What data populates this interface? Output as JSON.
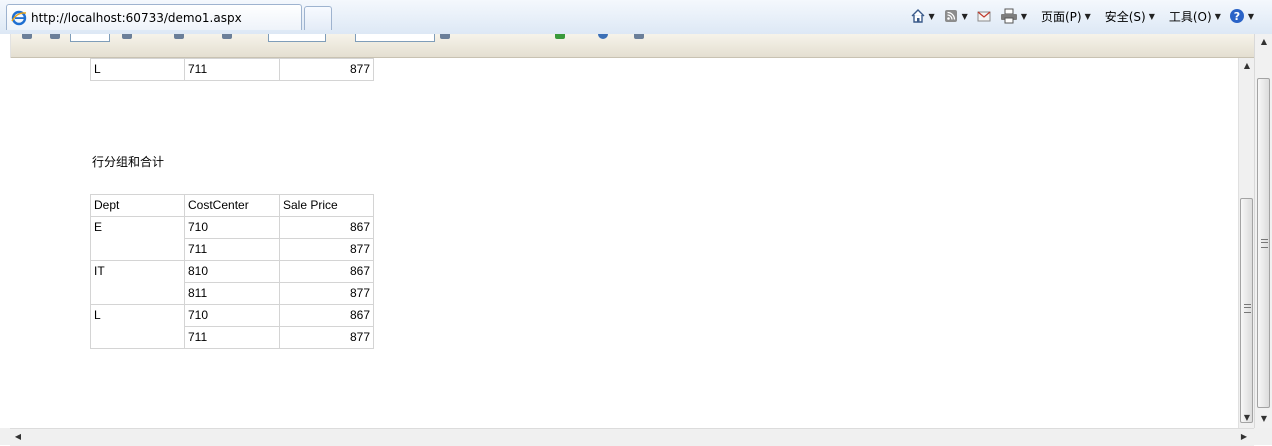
{
  "browser": {
    "address": "http://localhost:60733/demo1.aspx",
    "commands": [
      {
        "name": "home-icon",
        "label": ""
      },
      {
        "name": "rss-feed-icon",
        "label": ""
      },
      {
        "name": "read-mail-icon",
        "label": ""
      },
      {
        "name": "print-icon",
        "label": ""
      },
      {
        "name": "page-menu",
        "label": "页面(P)"
      },
      {
        "name": "safety-menu",
        "label": "安全(S)"
      },
      {
        "name": "tools-menu",
        "label": "工具(O)"
      },
      {
        "name": "help-icon",
        "label": ""
      }
    ]
  },
  "report": {
    "top_table_partial_row": {
      "dept": "L",
      "cost_center": "711",
      "sale_price": "877"
    },
    "section_title": "行分组和合计",
    "headers": [
      "Dept",
      "CostCenter",
      "Sale Price"
    ],
    "groups": [
      {
        "dept": "E",
        "rows": [
          {
            "cost_center": "710",
            "sale_price": "867"
          },
          {
            "cost_center": "711",
            "sale_price": "877"
          }
        ]
      },
      {
        "dept": "IT",
        "rows": [
          {
            "cost_center": "810",
            "sale_price": "867"
          },
          {
            "cost_center": "811",
            "sale_price": "877"
          }
        ]
      },
      {
        "dept": "L",
        "rows": [
          {
            "cost_center": "710",
            "sale_price": "867"
          },
          {
            "cost_center": "711",
            "sale_price": "877"
          }
        ]
      }
    ]
  }
}
